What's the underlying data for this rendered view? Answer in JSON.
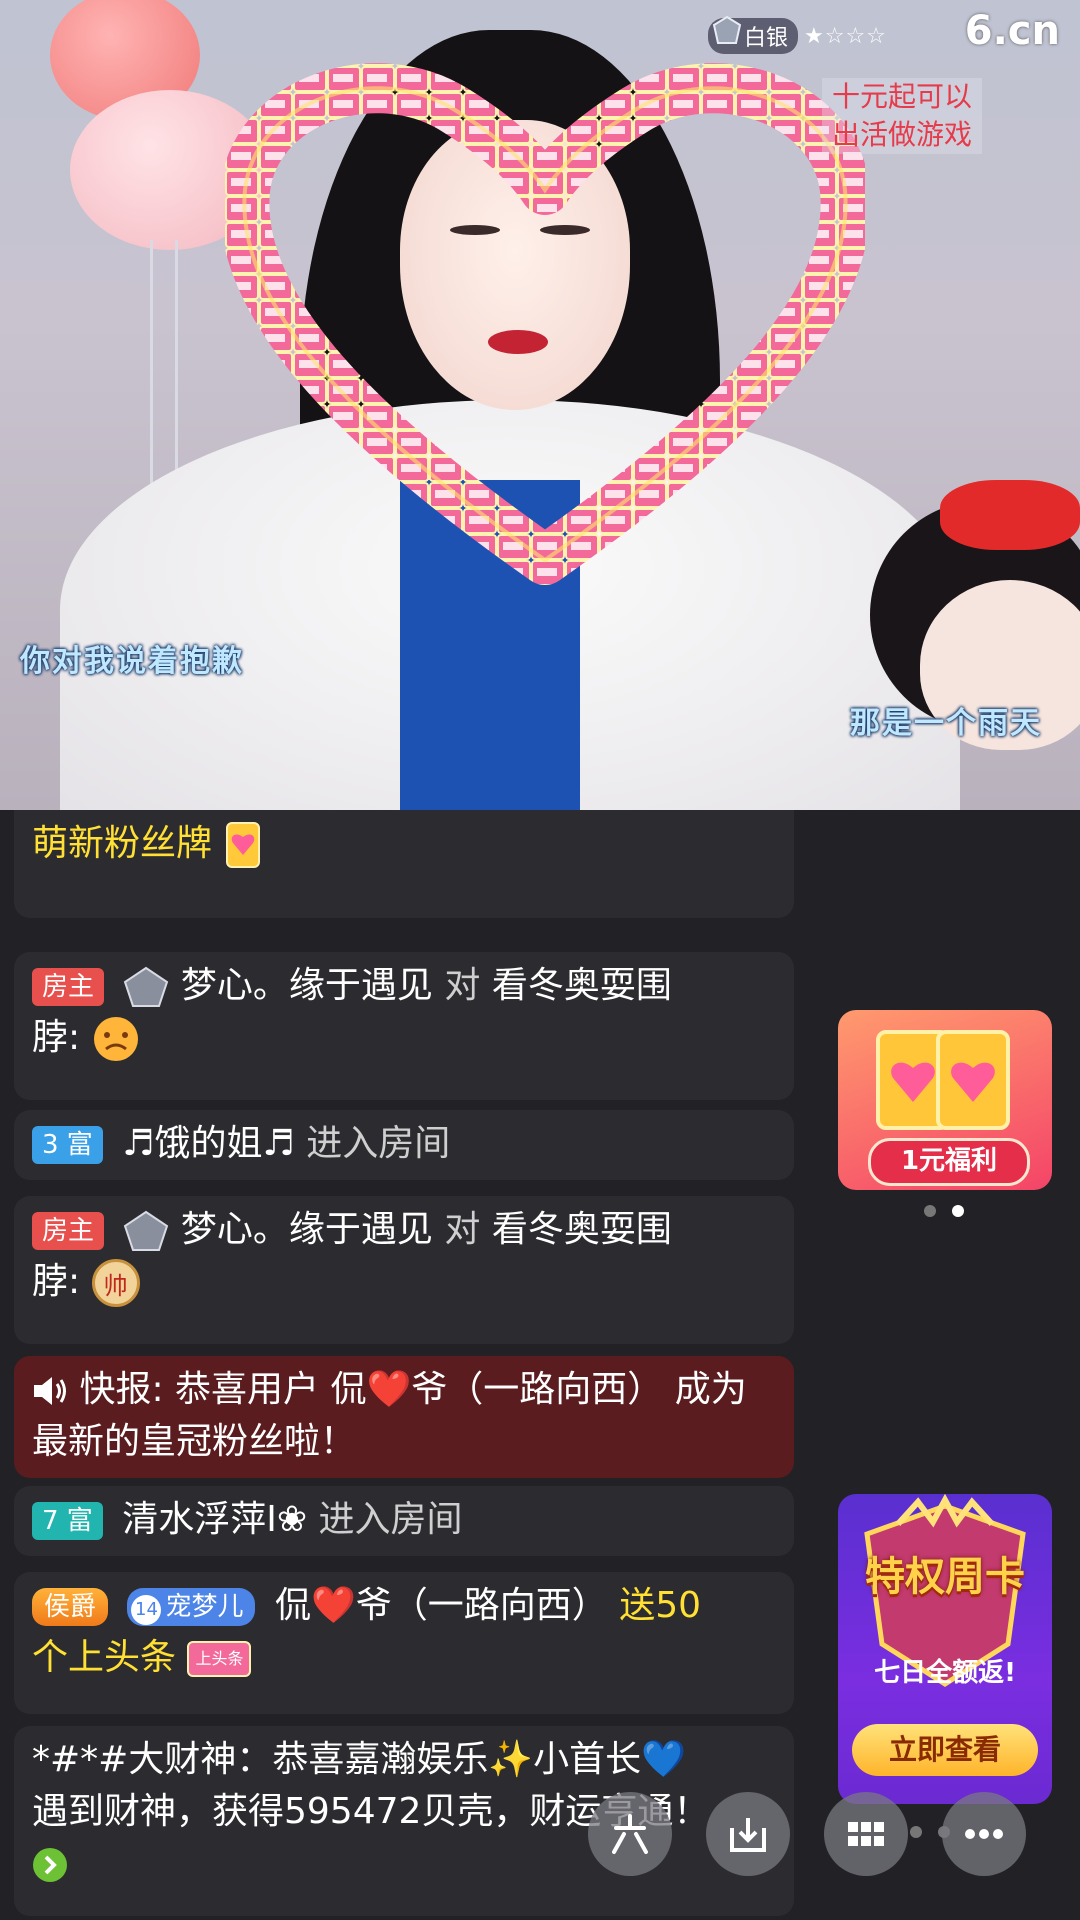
{
  "video": {
    "brand": "6.cn",
    "rank_label": "白银",
    "rank_stars": "★☆☆☆",
    "promo_line1": "十元起可以",
    "promo_line2": "出活做游戏",
    "lyric_left": "你对我说着抱歉",
    "lyric_right": "那是一个雨天",
    "gift_item_label": "上头条"
  },
  "chat": {
    "msg0_text": "萌新粉丝牌",
    "msg1": {
      "tag": "房主",
      "user": "梦心。缘于遇见",
      "mid": "对",
      "target": "看冬奥耍围",
      "tail": "脖:"
    },
    "msg2": {
      "tag": "3 富",
      "user": "♬饿的姐♬",
      "action": "进入房间"
    },
    "msg3": {
      "tag": "房主",
      "user": "梦心。缘于遇见",
      "mid": "对",
      "target": "看冬奥耍围",
      "tail": "脖:",
      "emoji_text": "帅"
    },
    "msg4": {
      "line1": "快报: 恭喜用户 侃❤️爷（一路向西） 成为",
      "line2": "最新的皇冠粉丝啦！"
    },
    "msg5": {
      "tag": "7 富",
      "user": "清水浮萍I❀",
      "action": "进入房间"
    },
    "msg6": {
      "noble": "侯爵",
      "fan_level": "14",
      "fan_name": "宠梦儿",
      "user": "侃❤️爷（一路向西）",
      "gift": "送50",
      "gift2": "个上头条"
    },
    "msg7": {
      "line1": "*#*#大财神：恭喜嘉瀚娱乐✨小首长💙",
      "line2": "遇到财神，获得595472贝壳，财运亨通！"
    }
  },
  "side": {
    "card1_btn": "1元福利",
    "card2_title": "特权周卡",
    "card2_sub": "七日全额返!",
    "card2_btn": "立即查看"
  },
  "colors": {
    "chat_bg": "#2c2c30",
    "alert_bg": "#5a1c1e",
    "gold_text": "#ffe033",
    "host_tag": "#e8504d"
  }
}
